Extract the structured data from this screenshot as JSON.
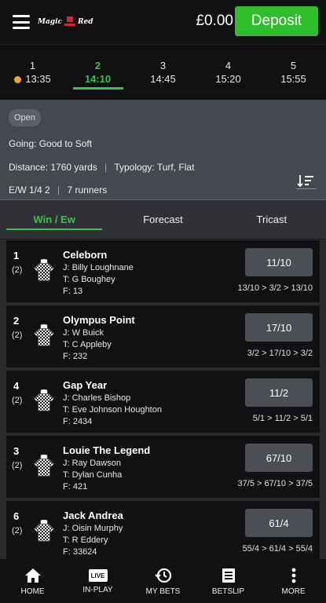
{
  "header": {
    "logo_word1": "Magic",
    "logo_word2": "Red",
    "balance": "£0.00",
    "deposit_label": "Deposit"
  },
  "race_tabs": [
    {
      "num": "1",
      "time": "13:35",
      "live_dot": true
    },
    {
      "num": "2",
      "time": "14:10",
      "active": true
    },
    {
      "num": "3",
      "time": "14:45"
    },
    {
      "num": "4",
      "time": "15:20"
    },
    {
      "num": "5",
      "time": "15:55"
    }
  ],
  "race_info": {
    "status": "Open",
    "going_label": "Going:",
    "going_value": "Good to Soft",
    "distance_label": "Distance:",
    "distance_value": "1760 yards",
    "typology_label": "Typology:",
    "typology_value": "Turf, Flat",
    "ew_terms": "E/W 1/4 2",
    "runners_count": "7 runners"
  },
  "bet_tabs": [
    {
      "label": "Win / Ew",
      "active": true
    },
    {
      "label": "Forecast"
    },
    {
      "label": "Tricast"
    }
  ],
  "runners": [
    {
      "number": "1",
      "draw": "(2)",
      "name": "Celeborn",
      "jockey": "J: Billy Loughnane",
      "trainer": "T: G Boughey",
      "form": "F: 13",
      "odds": "11/10",
      "history": [
        "13/10",
        "3/2",
        "13/10"
      ]
    },
    {
      "number": "2",
      "draw": "(2)",
      "name": "Olympus Point",
      "jockey": "J: W Buick",
      "trainer": "T: C Appleby",
      "form": "F: 232",
      "odds": "17/10",
      "history": [
        "3/2",
        "17/10",
        "3/2"
      ]
    },
    {
      "number": "4",
      "draw": "(2)",
      "name": "Gap Year",
      "jockey": "J: Charles Bishop",
      "trainer": "T: Eve Johnson Houghton",
      "form": "F: 2434",
      "odds": "11/2",
      "history": [
        "5/1",
        "11/2",
        "5/1"
      ]
    },
    {
      "number": "3",
      "draw": "(2)",
      "name": "Louie The Legend",
      "jockey": "J: Ray Dawson",
      "trainer": "T: Dylan Cunha",
      "form": "F: 421",
      "odds": "67/10",
      "history": [
        "37/5",
        "67/10",
        "37/5"
      ]
    },
    {
      "number": "6",
      "draw": "(2)",
      "name": "Jack Andrea",
      "jockey": "J: Oisin Murphy",
      "trainer": "T: R Eddery",
      "form": "F: 33624",
      "odds": "61/4",
      "history": [
        "55/4",
        "61/4",
        "55/4"
      ]
    }
  ],
  "bottom_nav": {
    "home": "HOME",
    "inplay": "IN-PLAY",
    "live_badge": "LIVE",
    "mybets": "MY BETS",
    "betslip": "BETSLIP",
    "more": "MORE"
  },
  "colors": {
    "accent": "#2ebd2b",
    "active_tab": "#34c64a",
    "live_dot": "#f3a622"
  }
}
